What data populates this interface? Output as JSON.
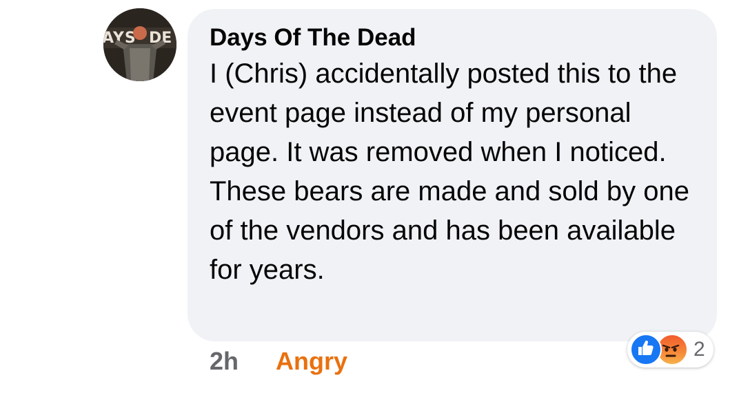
{
  "comment": {
    "author": "Days Of The Dead",
    "text": "I (Chris) accidentally posted this to the event page instead of my personal page. It was removed when I noticed. These bears are made and sold by one of the vendors and has been available for years.",
    "timestamp": "2h",
    "reaction_label": "Angry",
    "reactions": {
      "icons": [
        "like-icon",
        "angry-icon"
      ],
      "count": "2"
    }
  },
  "colors": {
    "bubble": "#f0f2f5",
    "angry_label": "#e9710f",
    "like": "#1877f2",
    "meta_gray": "#65676b"
  }
}
